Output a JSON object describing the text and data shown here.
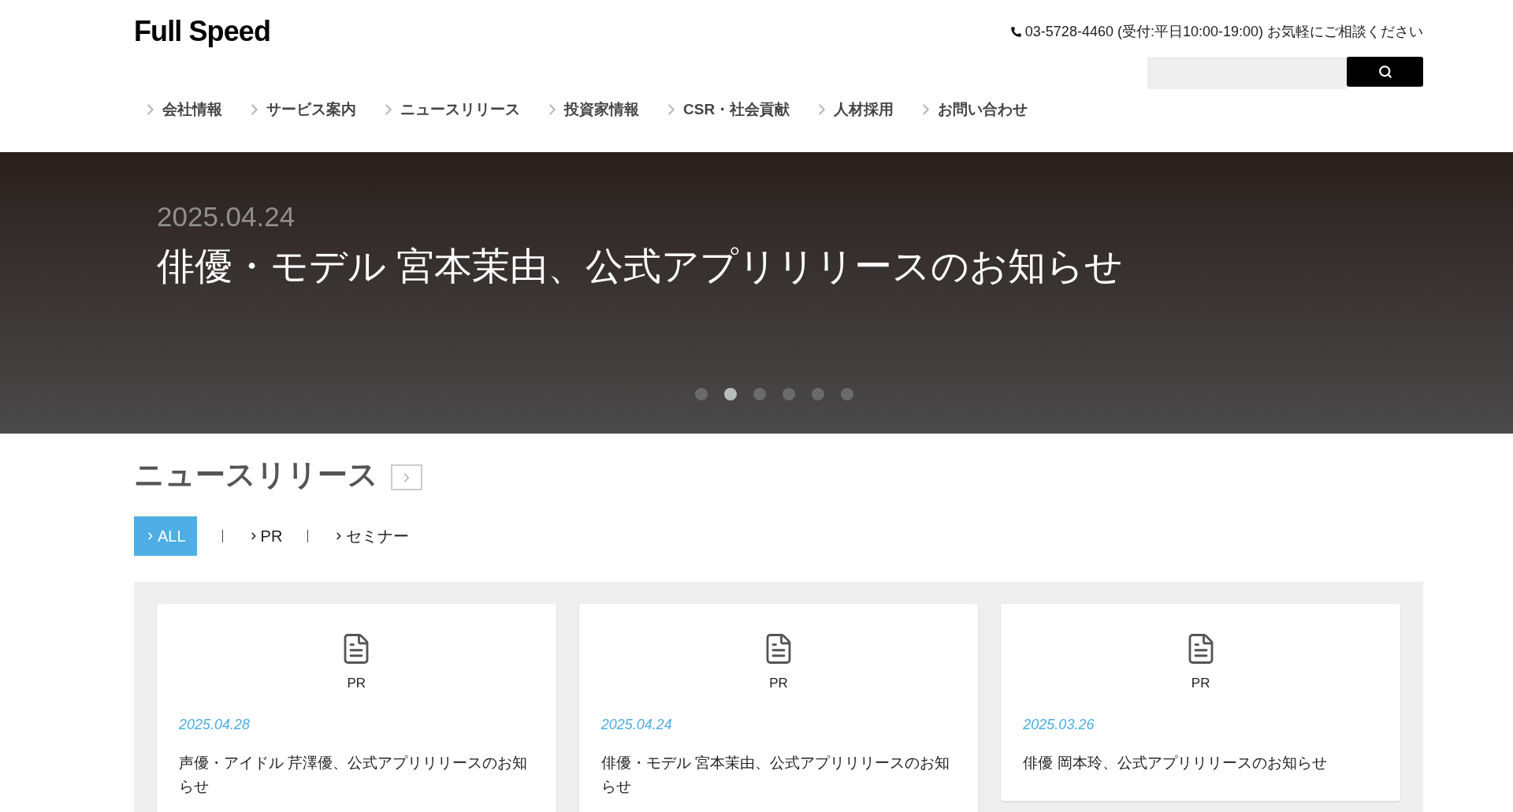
{
  "header": {
    "logo": "Full Speed",
    "phone": "03-5728-4460 (受付:平日10:00-19:00) お気軽にご相談ください"
  },
  "nav": [
    {
      "label": "会社情報"
    },
    {
      "label": "サービス案内"
    },
    {
      "label": "ニュースリリース"
    },
    {
      "label": "投資家情報"
    },
    {
      "label": "CSR・社会貢献"
    },
    {
      "label": "人材採用"
    },
    {
      "label": "お問い合わせ"
    }
  ],
  "hero": {
    "date": "2025.04.24",
    "title": "俳優・モデル 宮本茉由、公式アプリリリースのお知らせ",
    "dots": [
      {
        "selected": false
      },
      {
        "selected": true
      },
      {
        "selected": false
      },
      {
        "selected": false
      },
      {
        "selected": false
      },
      {
        "selected": false
      }
    ]
  },
  "news": {
    "title": "ニュースリリース",
    "filters": [
      {
        "label": "ALL",
        "selected": true
      },
      {
        "label": "PR",
        "selected": false
      },
      {
        "label": "セミナー",
        "selected": false
      }
    ],
    "cards": [
      {
        "category": "PR",
        "date": "2025.04.28",
        "title": "声優・アイドル 芹澤優、公式アプリリリースのお知らせ"
      },
      {
        "category": "PR",
        "date": "2025.04.24",
        "title": "俳優・モデル 宮本茉由、公式アプリリリースのお知らせ"
      },
      {
        "category": "PR",
        "date": "2025.03.26",
        "title": "俳優 岡本玲、公式アプリリリースのお知らせ"
      }
    ]
  }
}
